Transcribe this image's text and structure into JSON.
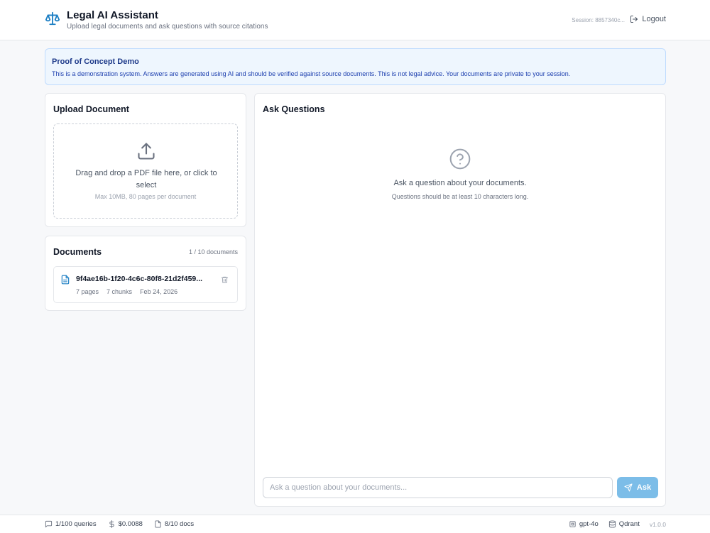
{
  "header": {
    "title": "Legal AI Assistant",
    "subtitle": "Upload legal documents and ask questions with source citations",
    "session": "Session: 8857340c...",
    "logout_label": "Logout",
    "brand_icon": "scale-icon"
  },
  "banner": {
    "title": "Proof of Concept Demo",
    "text": "This is a demonstration system. Answers are generated using AI and should be verified against source documents. This is not legal advice. Your documents are private to your session."
  },
  "upload": {
    "title": "Upload Document",
    "dropzone_text": "Drag and drop a PDF file here, or click to select",
    "limit_text": "Max 10MB, 80 pages per document",
    "icon": "upload-icon"
  },
  "documents": {
    "title": "Documents",
    "count": "1 / 10 documents",
    "items": [
      {
        "name": "9f4ae16b-1f20-4c6c-80f8-21d2f459...",
        "pages": "7 pages",
        "chunks": "7 chunks",
        "date": "Feb 24, 2026"
      }
    ]
  },
  "ask": {
    "title": "Ask Questions",
    "empty_title": "Ask a question about your documents.",
    "empty_sub": "Questions should be at least 10 characters long.",
    "input_placeholder": "Ask a question about your documents...",
    "input_value": "",
    "button_label": "Ask"
  },
  "footer": {
    "queries": "1/100 queries",
    "cost": "$0.0088",
    "docs": "8/10 docs",
    "model": "gpt-4o",
    "vector_db": "Qdrant",
    "version": "v1.0.0"
  },
  "colors": {
    "accent": "#7cbde8",
    "brand": "#1d7fc4",
    "banner_bg": "#eef6fe",
    "banner_title": "#1e3a8a"
  }
}
